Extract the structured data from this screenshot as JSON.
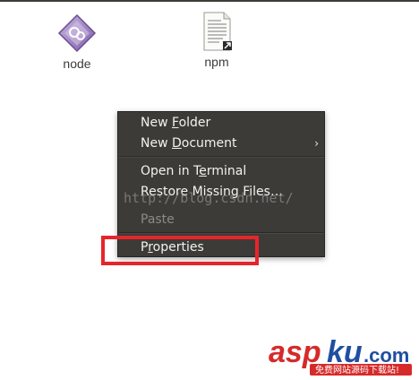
{
  "desktop": {
    "files": [
      {
        "label": "node",
        "icon": "node-executable-icon"
      },
      {
        "label": "npm",
        "icon": "text-file-link-icon"
      }
    ]
  },
  "context_menu": {
    "items": [
      {
        "label_pre": "New ",
        "label_u": "F",
        "label_post": "older",
        "enabled": true
      },
      {
        "label_pre": "New ",
        "label_u": "D",
        "label_post": "ocument",
        "enabled": true,
        "submenu_glyph": "›"
      },
      {
        "label_pre": "Open in T",
        "label_u": "e",
        "label_post": "rminal",
        "enabled": true
      },
      {
        "label_pre": "Restore Missing Files…",
        "label_u": "",
        "label_post": "",
        "enabled": true
      },
      {
        "label_pre": "Paste",
        "label_u": "",
        "label_post": "",
        "enabled": false
      },
      {
        "label_pre": "P",
        "label_u": "r",
        "label_post": "operties",
        "enabled": true
      }
    ]
  },
  "watermark": {
    "text": "http://blog.csdn.net/"
  },
  "logo": {
    "brand": "asp",
    "brand2": "ku",
    "tld": ".com",
    "tagline": "免费网站源码下载站!"
  },
  "colors": {
    "menu_bg": "#3c3b37",
    "menu_text": "#f2f2f0",
    "menu_disabled": "#8d8b85",
    "highlight": "#e8242b",
    "logo_red": "#d62a2a",
    "logo_blue": "#1f4fa0"
  }
}
